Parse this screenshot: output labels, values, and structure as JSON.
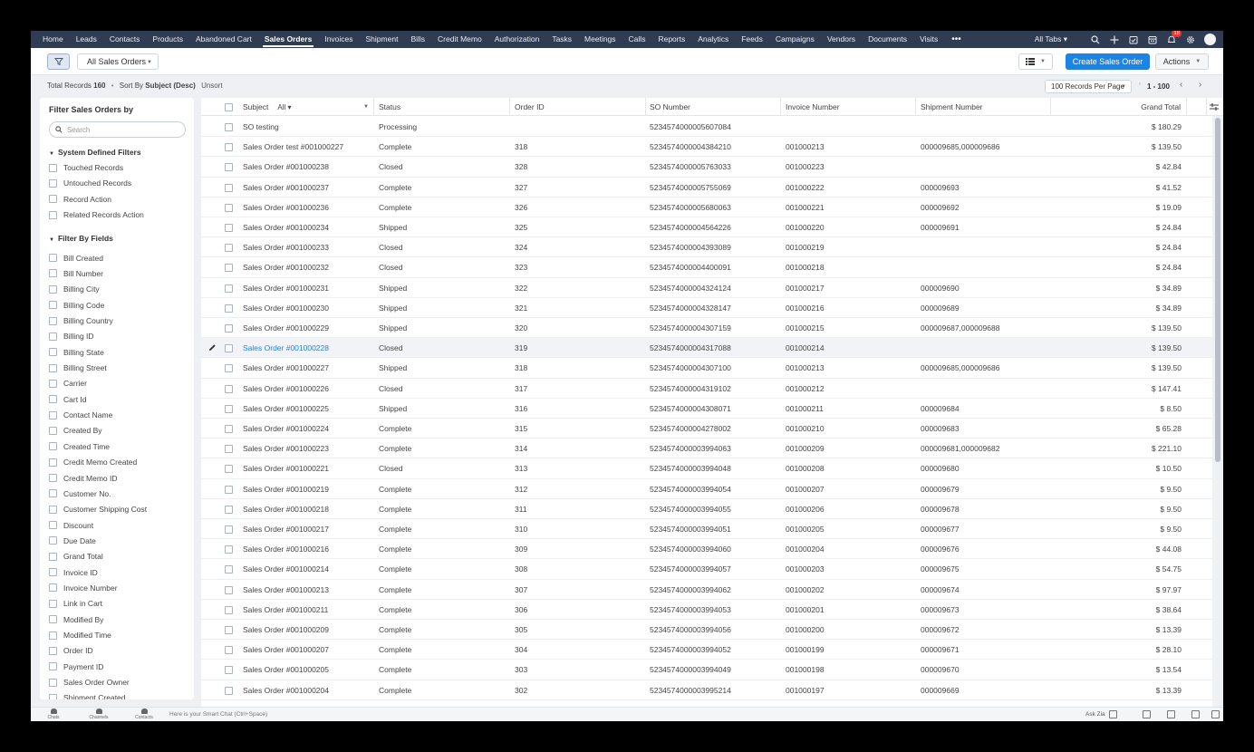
{
  "nav": {
    "tabs": [
      "Home",
      "Leads",
      "Contacts",
      "Products",
      "Abandoned Cart",
      "Sales Orders",
      "Invoices",
      "Shipment",
      "Bills",
      "Credit Memo",
      "Authorization",
      "Tasks",
      "Meetings",
      "Calls",
      "Reports",
      "Analytics",
      "Feeds",
      "Campaigns",
      "Vendors",
      "Documents",
      "Visits"
    ],
    "active_tab": "Sales Orders",
    "more": "•••",
    "all_tabs": "All Tabs ▾",
    "notification_count": "18"
  },
  "toolbar": {
    "view_name": "All Sales Orders",
    "create_label": "Create Sales Order",
    "actions_label": "Actions"
  },
  "info": {
    "total_label": "Total Records",
    "total_count": "160",
    "sort_label": "Sort By",
    "sort_value": "Subject (Desc)",
    "unsort": "Unsort",
    "per_page": "100 Records Per Page",
    "range": "1 - 100"
  },
  "sidebar": {
    "title": "Filter Sales Orders by",
    "search_placeholder": "Search",
    "system_group": "System Defined Filters",
    "system_filters": [
      "Touched Records",
      "Untouched Records",
      "Record Action",
      "Related Records Action"
    ],
    "fields_group": "Filter By Fields",
    "field_filters": [
      "Bill Created",
      "Bill Number",
      "Billing City",
      "Billing Code",
      "Billing Country",
      "Billing ID",
      "Billing State",
      "Billing Street",
      "Carrier",
      "Cart Id",
      "Contact Name",
      "Created By",
      "Created Time",
      "Credit Memo Created",
      "Credit Memo ID",
      "Customer No.",
      "Customer Shipping Cost",
      "Discount",
      "Due Date",
      "Grand Total",
      "Invoice ID",
      "Invoice Number",
      "Link in Cart",
      "Modified By",
      "Modified Time",
      "Order ID",
      "Payment ID",
      "Sales Order Owner",
      "Shipment Created"
    ]
  },
  "table": {
    "columns": {
      "subject": "Subject",
      "subject_filter": "All ▾",
      "status": "Status",
      "order_id": "Order ID",
      "so_number": "SO Number",
      "invoice_number": "Invoice Number",
      "shipment_number": "Shipment Number",
      "grand_total": "Grand Total"
    },
    "rows": [
      [
        "SO testing",
        "Processing",
        "",
        "5234574000005607084",
        "",
        "",
        "$ 180.29"
      ],
      [
        "Sales Order test #001000227",
        "Complete",
        "318",
        "5234574000004384210",
        "001000213",
        "000009685,000009686",
        "$ 139.50"
      ],
      [
        "Sales Order #001000238",
        "Closed",
        "328",
        "5234574000005763033",
        "001000223",
        "",
        "$ 42.84"
      ],
      [
        "Sales Order #001000237",
        "Complete",
        "327",
        "5234574000005755069",
        "001000222",
        "000009693",
        "$ 41.52"
      ],
      [
        "Sales Order #001000236",
        "Complete",
        "326",
        "5234574000005680063",
        "001000221",
        "000009692",
        "$ 19.09"
      ],
      [
        "Sales Order #001000234",
        "Shipped",
        "325",
        "5234574000004564226",
        "001000220",
        "000009691",
        "$ 24.84"
      ],
      [
        "Sales Order #001000233",
        "Closed",
        "324",
        "5234574000004393089",
        "001000219",
        "",
        "$ 24.84"
      ],
      [
        "Sales Order #001000232",
        "Closed",
        "323",
        "5234574000004400091",
        "001000218",
        "",
        "$ 24.84"
      ],
      [
        "Sales Order #001000231",
        "Shipped",
        "322",
        "5234574000004324124",
        "001000217",
        "000009690",
        "$ 34.89"
      ],
      [
        "Sales Order #001000230",
        "Shipped",
        "321",
        "5234574000004328147",
        "001000216",
        "000009689",
        "$ 34.89"
      ],
      [
        "Sales Order #001000229",
        "Shipped",
        "320",
        "5234574000004307159",
        "001000215",
        "000009687,000009688",
        "$ 139.50"
      ],
      [
        "Sales Order #001000228",
        "Closed",
        "319",
        "5234574000004317088",
        "001000214",
        "",
        "$ 139.50"
      ],
      [
        "Sales Order #001000227",
        "Shipped",
        "318",
        "5234574000004307100",
        "001000213",
        "000009685,000009686",
        "$ 139.50"
      ],
      [
        "Sales Order #001000226",
        "Closed",
        "317",
        "5234574000004319102",
        "001000212",
        "",
        "$ 147.41"
      ],
      [
        "Sales Order #001000225",
        "Shipped",
        "316",
        "5234574000004308071",
        "001000211",
        "000009684",
        "$ 8.50"
      ],
      [
        "Sales Order #001000224",
        "Complete",
        "315",
        "5234574000004278002",
        "001000210",
        "000009683",
        "$ 65.28"
      ],
      [
        "Sales Order #001000223",
        "Complete",
        "314",
        "5234574000003994063",
        "001000209",
        "000009681,000009682",
        "$ 221.10"
      ],
      [
        "Sales Order #001000221",
        "Closed",
        "313",
        "5234574000003994048",
        "001000208",
        "000009680",
        "$ 10.50"
      ],
      [
        "Sales Order #001000219",
        "Complete",
        "312",
        "5234574000003994054",
        "001000207",
        "000009679",
        "$ 9.50"
      ],
      [
        "Sales Order #001000218",
        "Complete",
        "311",
        "5234574000003994055",
        "001000206",
        "000009678",
        "$ 9.50"
      ],
      [
        "Sales Order #001000217",
        "Complete",
        "310",
        "5234574000003994051",
        "001000205",
        "000009677",
        "$ 9.50"
      ],
      [
        "Sales Order #001000216",
        "Complete",
        "309",
        "5234574000003994060",
        "001000204",
        "000009676",
        "$ 44.08"
      ],
      [
        "Sales Order #001000214",
        "Complete",
        "308",
        "5234574000003994057",
        "001000203",
        "000009675",
        "$ 54.75"
      ],
      [
        "Sales Order #001000213",
        "Complete",
        "307",
        "5234574000003994062",
        "001000202",
        "000009674",
        "$ 97.97"
      ],
      [
        "Sales Order #001000211",
        "Complete",
        "306",
        "5234574000003994053",
        "001000201",
        "000009673",
        "$ 38.64"
      ],
      [
        "Sales Order #001000209",
        "Complete",
        "305",
        "5234574000003994056",
        "001000200",
        "000009672",
        "$ 13.39"
      ],
      [
        "Sales Order #001000207",
        "Complete",
        "304",
        "5234574000003994052",
        "001000199",
        "000009671",
        "$ 28.10"
      ],
      [
        "Sales Order #001000205",
        "Complete",
        "303",
        "5234574000003994049",
        "001000198",
        "000009670",
        "$ 13.54"
      ],
      [
        "Sales Order #001000204",
        "Complete",
        "302",
        "5234574000003995214",
        "001000197",
        "000009669",
        "$ 13.39"
      ]
    ],
    "hover_row": 11
  },
  "footer": {
    "chats": "Chats",
    "channels": "Channels",
    "contacts": "Contacts",
    "smart_chat": "Here is your Smart Chat (Ctrl+Space)",
    "ask_zia": "Ask Zia"
  },
  "colors": {
    "nav_bg": "#303c52",
    "accent": "#1d84e6",
    "link": "#1d84e6"
  }
}
